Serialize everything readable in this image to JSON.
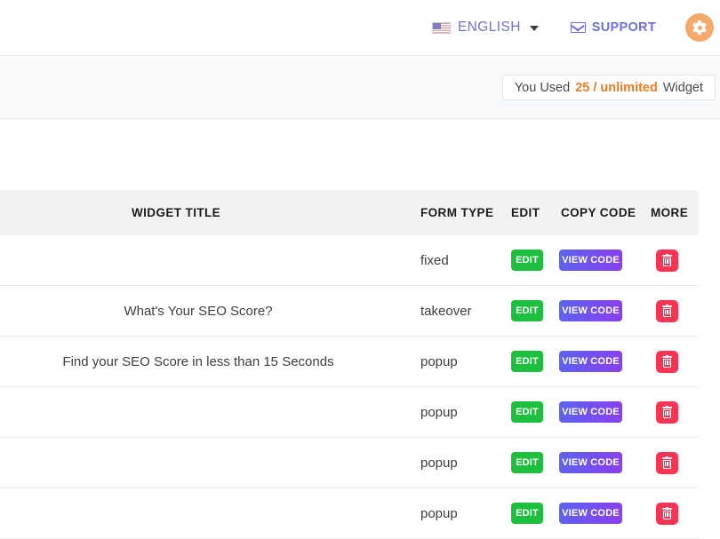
{
  "topbar": {
    "language": {
      "label": "ENGLISH",
      "flag_icon": "us-flag-icon",
      "caret_icon": "chevron-down-icon"
    },
    "support": {
      "label": "SUPPORT",
      "icon": "envelope-icon"
    },
    "settings": {
      "icon": "gear-icon",
      "color": "#f5a96b"
    }
  },
  "usage": {
    "prefix": "You Used",
    "count": "25 / unlimited",
    "suffix": "Widget",
    "count_color": "#f07c24"
  },
  "table": {
    "columns": {
      "title": "WIDGET TITLE",
      "form_type": "FORM TYPE",
      "edit": "EDIT",
      "copy_code": "COPY CODE",
      "more": "MORE"
    },
    "actions": {
      "edit_label": "EDIT",
      "view_code_label": "VIEW CODE",
      "delete_icon": "trash-icon",
      "edit_color": "#1dbf3e",
      "view_code_color": "#6b4df0",
      "delete_color": "#fb3453"
    },
    "rows": [
      {
        "title": "",
        "form_type": "fixed"
      },
      {
        "title": "What's Your SEO Score?",
        "form_type": "takeover"
      },
      {
        "title": "Find your SEO Score in less than 15 Seconds",
        "form_type": "popup"
      },
      {
        "title": "",
        "form_type": "popup"
      },
      {
        "title": "",
        "form_type": "popup"
      },
      {
        "title": "",
        "form_type": "popup"
      }
    ]
  }
}
